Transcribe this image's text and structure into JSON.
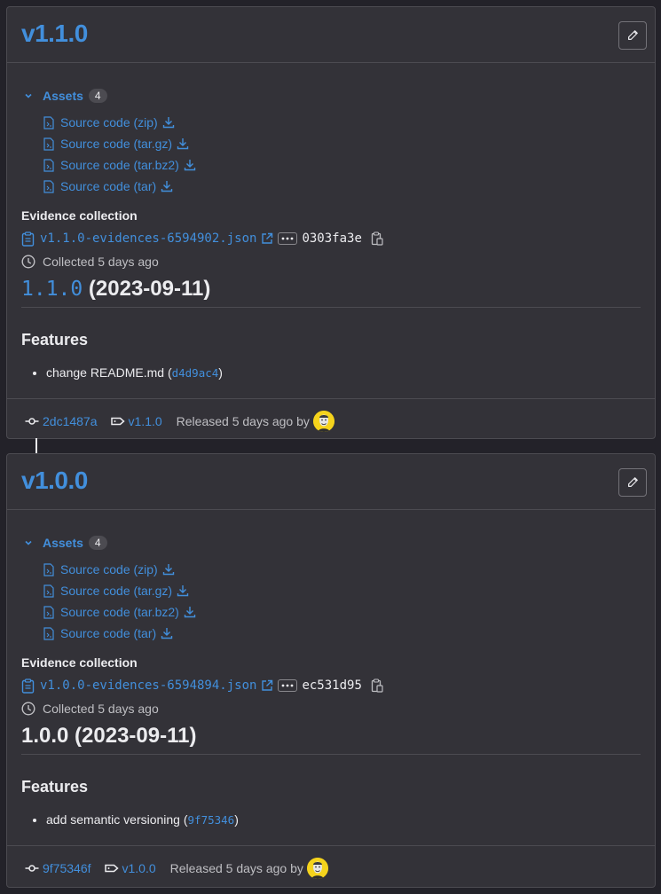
{
  "releases": [
    {
      "title": "v1.1.0",
      "assets_label": "Assets",
      "assets_count": "4",
      "assets": [
        {
          "label": "Source code (zip)"
        },
        {
          "label": "Source code (tar.gz)"
        },
        {
          "label": "Source code (tar.bz2)"
        },
        {
          "label": "Source code (tar)"
        }
      ],
      "evidence_title": "Evidence collection",
      "evidence_file": "v1.1.0-evidences-6594902.json",
      "evidence_sha": "0303fa3e",
      "collected": "Collected 5 days ago",
      "version_link": "1.1.0",
      "version_date": " (2023-09-11)",
      "features_title": "Features",
      "features": [
        {
          "text": "change README.md (",
          "commit": "d4d9ac4",
          "close": ")"
        }
      ],
      "footer": {
        "commit": "2dc1487a",
        "tag": "v1.1.0",
        "released": "Released 5 days ago by"
      }
    },
    {
      "title": "v1.0.0",
      "assets_label": "Assets",
      "assets_count": "4",
      "assets": [
        {
          "label": "Source code (zip)"
        },
        {
          "label": "Source code (tar.gz)"
        },
        {
          "label": "Source code (tar.bz2)"
        },
        {
          "label": "Source code (tar)"
        }
      ],
      "evidence_title": "Evidence collection",
      "evidence_file": "v1.0.0-evidences-6594894.json",
      "evidence_sha": "ec531d95",
      "collected": "Collected 5 days ago",
      "version_text": "1.0.0 (2023-09-11)",
      "features_title": "Features",
      "features": [
        {
          "text": "add semantic versioning (",
          "commit": "9f75346",
          "close": ")"
        }
      ],
      "footer": {
        "commit": "9f75346f",
        "tag": "v1.0.0",
        "released": "Released 5 days ago by"
      }
    }
  ],
  "colors": {
    "background": "#232229",
    "card": "#333238",
    "link": "#428fdc",
    "text": "#ececef",
    "muted": "#bfbfc3",
    "avatar_bg": "#f5d31c"
  }
}
